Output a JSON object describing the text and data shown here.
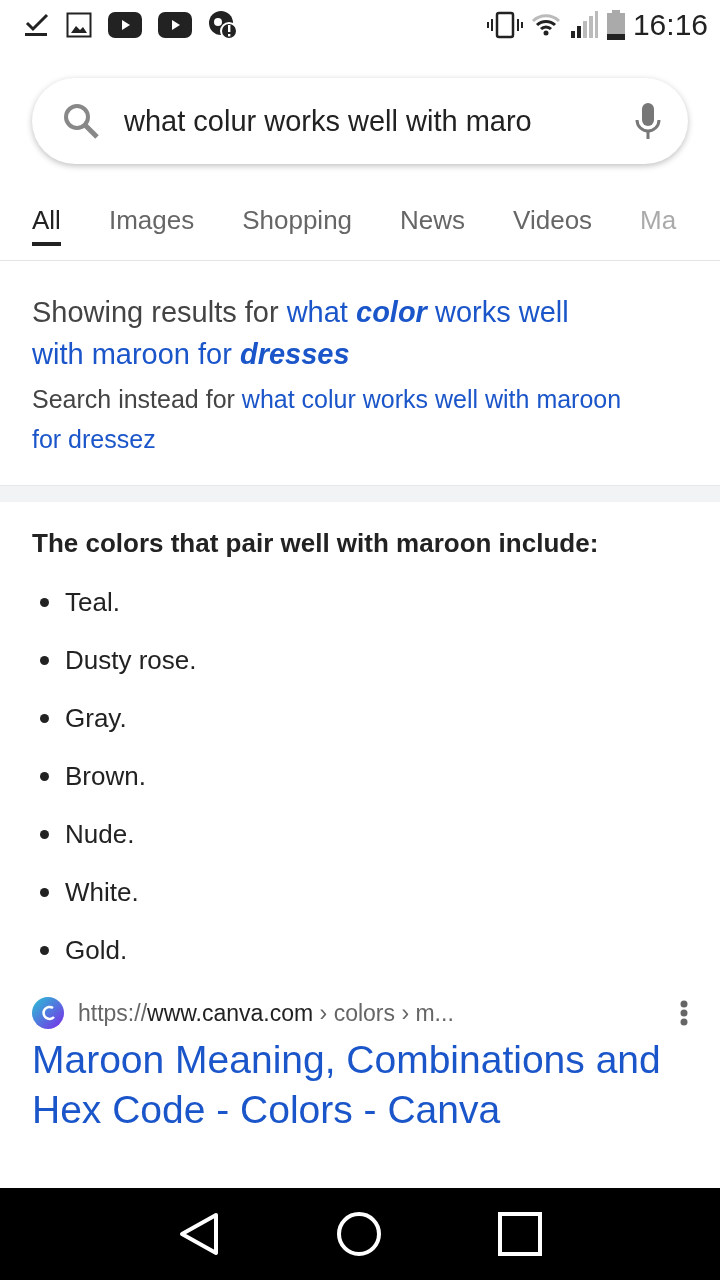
{
  "status_bar": {
    "time": "16:16"
  },
  "search": {
    "value": "what colur works well with maro"
  },
  "tabs": [
    {
      "label": "All",
      "selected": true
    },
    {
      "label": "Images",
      "selected": false
    },
    {
      "label": "Shopping",
      "selected": false
    },
    {
      "label": "News",
      "selected": false
    },
    {
      "label": "Videos",
      "selected": false
    },
    {
      "label": "Ma",
      "selected": false
    }
  ],
  "correction": {
    "showing_prefix": "Showing results for",
    "showing_query_lines": [
      "what **color** works well",
      "with maroon for **dresses**"
    ],
    "instead_prefix": "Search instead for",
    "instead_query_lines": [
      "what colur works well with maroon",
      "for dressez"
    ]
  },
  "answer": {
    "heading": "The colors that pair well with maroon include:",
    "items": [
      "Teal.",
      "Dusty rose.",
      "Gray.",
      "Brown.",
      "Nude.",
      "White.",
      "Gold."
    ]
  },
  "result": {
    "url_scheme": "https://",
    "url_domain": "www.canva.com",
    "url_path": "› colors › m...",
    "title": "Maroon Meaning, Combinations and Hex Code - Colors - Canva"
  }
}
